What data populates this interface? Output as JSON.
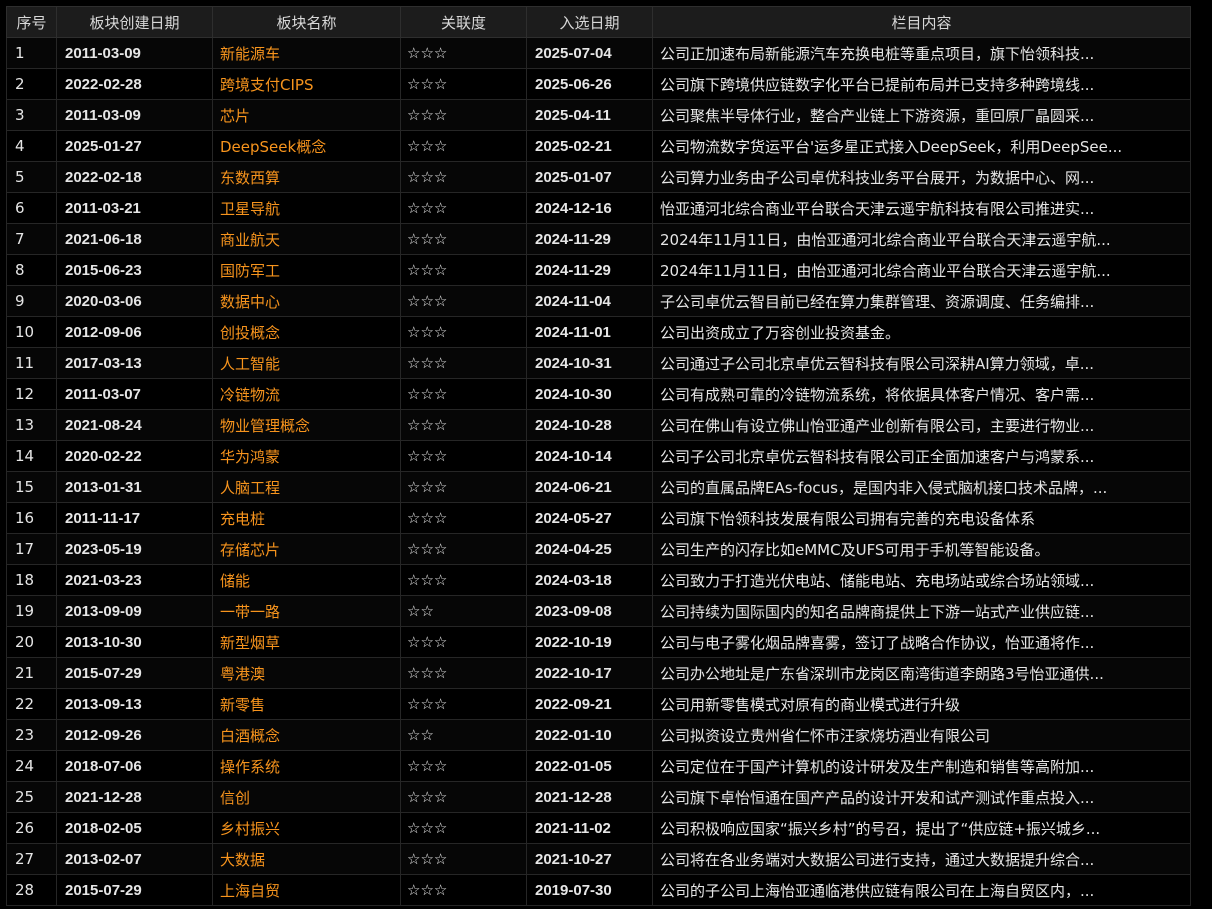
{
  "headers": {
    "idx": "序号",
    "create_date": "板块创建日期",
    "name": "板块名称",
    "relevance": "关联度",
    "select_date": "入选日期",
    "content": "栏目内容"
  },
  "colors": {
    "background": "#000000",
    "name_text": "#f7941d",
    "header_bg": "#1c1c1c",
    "text": "#e6e6e6"
  },
  "rows": [
    {
      "idx": "1",
      "create_date": "2011-03-09",
      "name": "新能源车",
      "relevance": "☆☆☆",
      "select_date": "2025-07-04",
      "content": "公司正加速布局新能源汽车充换电桩等重点项目，旗下怡领科技..."
    },
    {
      "idx": "2",
      "create_date": "2022-02-28",
      "name": "跨境支付CIPS",
      "relevance": "☆☆☆",
      "select_date": "2025-06-26",
      "content": "公司旗下跨境供应链数字化平台已提前布局并已支持多种跨境线..."
    },
    {
      "idx": "3",
      "create_date": "2011-03-09",
      "name": "芯片",
      "relevance": "☆☆☆",
      "select_date": "2025-04-11",
      "content": "公司聚焦半导体行业，整合产业链上下游资源，重回原厂晶圆采..."
    },
    {
      "idx": "4",
      "create_date": "2025-01-27",
      "name": "DeepSeek概念",
      "relevance": "☆☆☆",
      "select_date": "2025-02-21",
      "content": "公司物流数字货运平台'运多星正式接入DeepSeek，利用DeepSee..."
    },
    {
      "idx": "5",
      "create_date": "2022-02-18",
      "name": "东数西算",
      "relevance": "☆☆☆",
      "select_date": "2025-01-07",
      "content": "公司算力业务由子公司卓优科技业务平台展开，为数据中心、网..."
    },
    {
      "idx": "6",
      "create_date": "2011-03-21",
      "name": "卫星导航",
      "relevance": "☆☆☆",
      "select_date": "2024-12-16",
      "content": "怡亚通河北综合商业平台联合天津云遥宇航科技有限公司推进实..."
    },
    {
      "idx": "7",
      "create_date": "2021-06-18",
      "name": "商业航天",
      "relevance": "☆☆☆",
      "select_date": "2024-11-29",
      "content": "2024年11月11日，由怡亚通河北综合商业平台联合天津云遥宇航..."
    },
    {
      "idx": "8",
      "create_date": "2015-06-23",
      "name": "国防军工",
      "relevance": "☆☆☆",
      "select_date": "2024-11-29",
      "content": "2024年11月11日，由怡亚通河北综合商业平台联合天津云遥宇航..."
    },
    {
      "idx": "9",
      "create_date": "2020-03-06",
      "name": "数据中心",
      "relevance": "☆☆☆",
      "select_date": "2024-11-04",
      "content": "子公司卓优云智目前已经在算力集群管理、资源调度、任务编排..."
    },
    {
      "idx": "10",
      "create_date": "2012-09-06",
      "name": "创投概念",
      "relevance": "☆☆☆",
      "select_date": "2024-11-01",
      "content": "公司出资成立了万容创业投资基金。"
    },
    {
      "idx": "11",
      "create_date": "2017-03-13",
      "name": "人工智能",
      "relevance": "☆☆☆",
      "select_date": "2024-10-31",
      "content": "公司通过子公司北京卓优云智科技有限公司深耕AI算力领域，卓..."
    },
    {
      "idx": "12",
      "create_date": "2011-03-07",
      "name": "冷链物流",
      "relevance": "☆☆☆",
      "select_date": "2024-10-30",
      "content": "公司有成熟可靠的冷链物流系统，将依据具体客户情况、客户需..."
    },
    {
      "idx": "13",
      "create_date": "2021-08-24",
      "name": "物业管理概念",
      "relevance": "☆☆☆",
      "select_date": "2024-10-28",
      "content": "公司在佛山有设立佛山怡亚通产业创新有限公司，主要进行物业..."
    },
    {
      "idx": "14",
      "create_date": "2020-02-22",
      "name": "华为鸿蒙",
      "relevance": "☆☆☆",
      "select_date": "2024-10-14",
      "content": "公司子公司北京卓优云智科技有限公司正全面加速客户与鸿蒙系..."
    },
    {
      "idx": "15",
      "create_date": "2013-01-31",
      "name": "人脑工程",
      "relevance": "☆☆☆",
      "select_date": "2024-06-21",
      "content": "公司的直属品牌EAs-focus，是国内非入侵式脑机接口技术品牌，..."
    },
    {
      "idx": "16",
      "create_date": "2011-11-17",
      "name": "充电桩",
      "relevance": "☆☆☆",
      "select_date": "2024-05-27",
      "content": "公司旗下怡领科技发展有限公司拥有完善的充电设备体系"
    },
    {
      "idx": "17",
      "create_date": "2023-05-19",
      "name": "存储芯片",
      "relevance": "☆☆☆",
      "select_date": "2024-04-25",
      "content": "公司生产的闪存比如eMMC及UFS可用于手机等智能设备。"
    },
    {
      "idx": "18",
      "create_date": "2021-03-23",
      "name": "储能",
      "relevance": "☆☆☆",
      "select_date": "2024-03-18",
      "content": "公司致力于打造光伏电站、储能电站、充电场站或综合场站领域..."
    },
    {
      "idx": "19",
      "create_date": "2013-09-09",
      "name": "一带一路",
      "relevance": "☆☆",
      "select_date": "2023-09-08",
      "content": "公司持续为国际国内的知名品牌商提供上下游一站式产业供应链..."
    },
    {
      "idx": "20",
      "create_date": "2013-10-30",
      "name": "新型烟草",
      "relevance": "☆☆☆",
      "select_date": "2022-10-19",
      "content": "公司与电子雾化烟品牌喜雾，签订了战略合作协议，怡亚通将作..."
    },
    {
      "idx": "21",
      "create_date": "2015-07-29",
      "name": "粤港澳",
      "relevance": "☆☆☆",
      "select_date": "2022-10-17",
      "content": "公司办公地址是广东省深圳市龙岗区南湾街道李朗路3号怡亚通供..."
    },
    {
      "idx": "22",
      "create_date": "2013-09-13",
      "name": "新零售",
      "relevance": "☆☆☆",
      "select_date": "2022-09-21",
      "content": "公司用新零售模式对原有的商业模式进行升级"
    },
    {
      "idx": "23",
      "create_date": "2012-09-26",
      "name": "白酒概念",
      "relevance": "☆☆",
      "select_date": "2022-01-10",
      "content": "公司拟资设立贵州省仁怀市汪家烧坊酒业有限公司"
    },
    {
      "idx": "24",
      "create_date": "2018-07-06",
      "name": "操作系统",
      "relevance": "☆☆☆",
      "select_date": "2022-01-05",
      "content": "公司定位在于国产计算机的设计研发及生产制造和销售等高附加..."
    },
    {
      "idx": "25",
      "create_date": "2021-12-28",
      "name": "信创",
      "relevance": "☆☆☆",
      "select_date": "2021-12-28",
      "content": "公司旗下卓怡恒通在国产产品的设计开发和试产测试作重点投入..."
    },
    {
      "idx": "26",
      "create_date": "2018-02-05",
      "name": "乡村振兴",
      "relevance": "☆☆☆",
      "select_date": "2021-11-02",
      "content": "公司积极响应国家“振兴乡村”的号召，提出了“供应链+振兴城乡..."
    },
    {
      "idx": "27",
      "create_date": "2013-02-07",
      "name": "大数据",
      "relevance": "☆☆☆",
      "select_date": "2021-10-27",
      "content": "公司将在各业务端对大数据公司进行支持，通过大数据提升综合..."
    },
    {
      "idx": "28",
      "create_date": "2015-07-29",
      "name": "上海自贸",
      "relevance": "☆☆☆",
      "select_date": "2019-07-30",
      "content": "公司的子公司上海怡亚通临港供应链有限公司在上海自贸区内，..."
    }
  ]
}
